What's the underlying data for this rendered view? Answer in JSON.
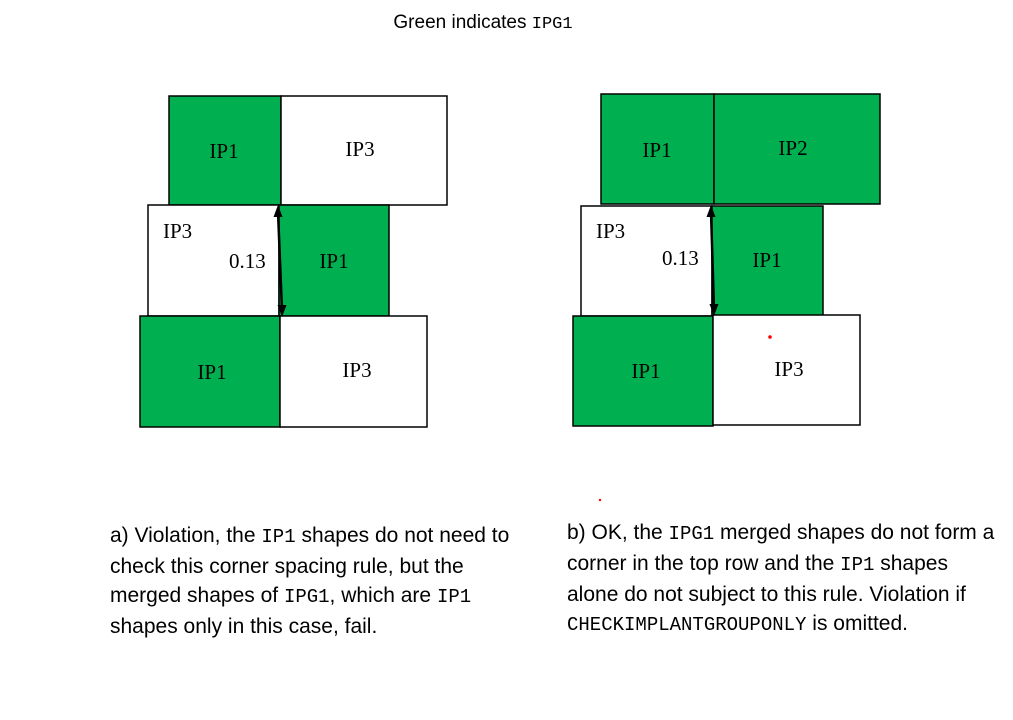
{
  "title": {
    "text": "Green indicates ",
    "code": "IPG1"
  },
  "colors": {
    "green": "#00b050",
    "white": "#ffffff",
    "border": "#000000",
    "marker": "#ff0000"
  },
  "diagram_a": {
    "cells": [
      "IP1",
      "IP3",
      "IP3",
      "IP1",
      "IP1",
      "IP3"
    ],
    "dimension": "0.13"
  },
  "diagram_b": {
    "cells": [
      "IP1",
      "IP2",
      "IP3",
      "IP1",
      "IP1",
      "IP3"
    ],
    "dimension": "0.13"
  },
  "caption_a": {
    "t1": "a) Violation, the ",
    "c1": "IP1",
    "t2": " shapes do not need to check this corner spacing rule, but the merged shapes of ",
    "c2": "IPG1",
    "t3": ", which are ",
    "c3": "IP1",
    "t4": " shapes only in this case, fail."
  },
  "caption_b": {
    "t1": "b) OK, the ",
    "c1": "IPG1",
    "t2": " merged shapes do not form a corner in the top row and the ",
    "c2": "IP1",
    "t3": " shapes alone do not subject to this rule. Violation if ",
    "c3": "CHECKIMPLANTGROUPONLY",
    "t4": " is omitted."
  }
}
